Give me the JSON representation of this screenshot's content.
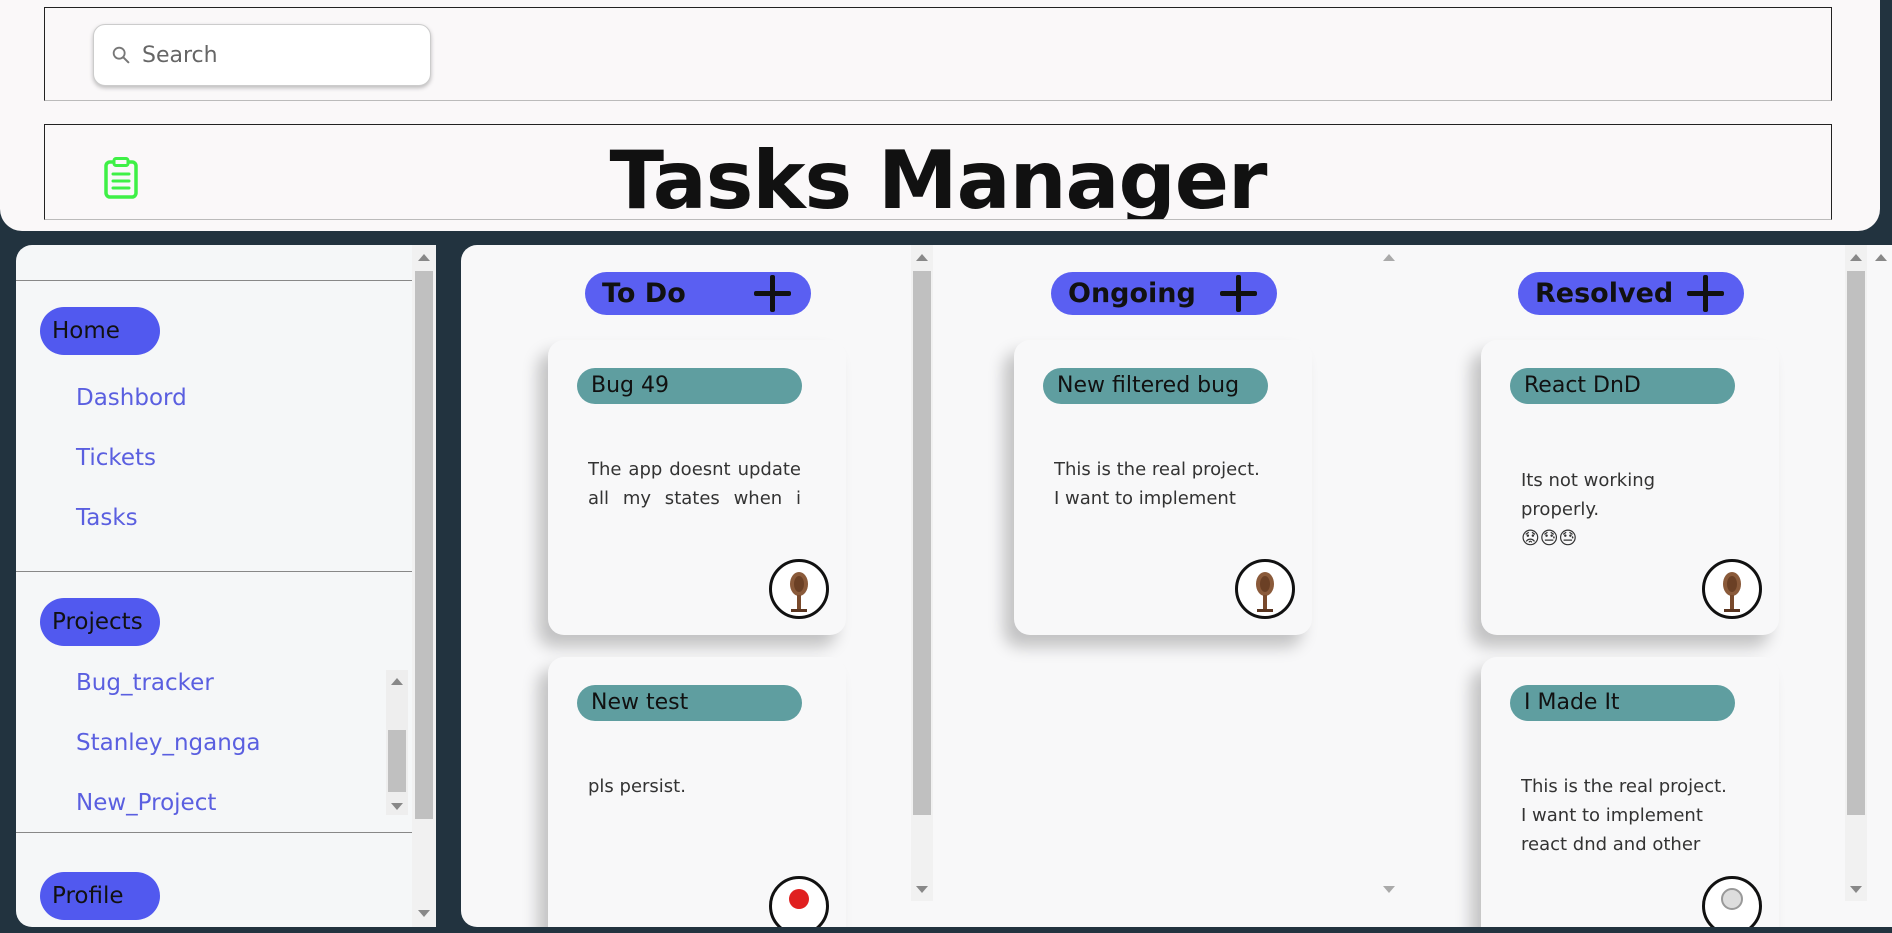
{
  "header": {
    "search_placeholder": "Search",
    "title": "Tasks Manager",
    "logo_icon": "clipboard-icon",
    "logo_color": "#3ef046"
  },
  "sidebar": {
    "sections": [
      {
        "label": "Home",
        "items": [
          "Dashbord",
          "Tickets",
          "Tasks"
        ]
      },
      {
        "label": "Projects",
        "items": [
          "Bug_tracker",
          "Stanley_nganga",
          "New_Project"
        ]
      },
      {
        "label": "Profile",
        "items": []
      }
    ]
  },
  "board": {
    "columns": [
      {
        "title": "To Do",
        "add_icon": "plus-icon",
        "cards": [
          {
            "tag": "Bug 49",
            "description": "The app doesnt update all my states when i create a new project.",
            "avatar": "wooden-figure-avatar"
          },
          {
            "tag": "New test",
            "description": "pls persist.",
            "avatar": "red-avatar"
          }
        ]
      },
      {
        "title": "Ongoing",
        "add_icon": "plus-icon",
        "cards": [
          {
            "tag": "New filtered bug",
            "description": "This is the real project. I want to implement react dnd and other cool stuff.",
            "avatar": "wooden-figure-avatar"
          }
        ]
      },
      {
        "title": "Resolved",
        "add_icon": "plus-icon",
        "cards": [
          {
            "tag": "React DnD",
            "description": "Its not working properly.",
            "emojis": "😟😓😓",
            "avatar": "wooden-figure-avatar"
          },
          {
            "tag": "I Made It",
            "description": "This is the real project. I want to implement react dnd and other cool stuff.",
            "avatar": "grey-avatar"
          }
        ]
      }
    ]
  },
  "colors": {
    "accent": "#5a5ff2",
    "tag": "#5f9ea0",
    "link": "#5a5fe0",
    "background": "#22333f"
  }
}
